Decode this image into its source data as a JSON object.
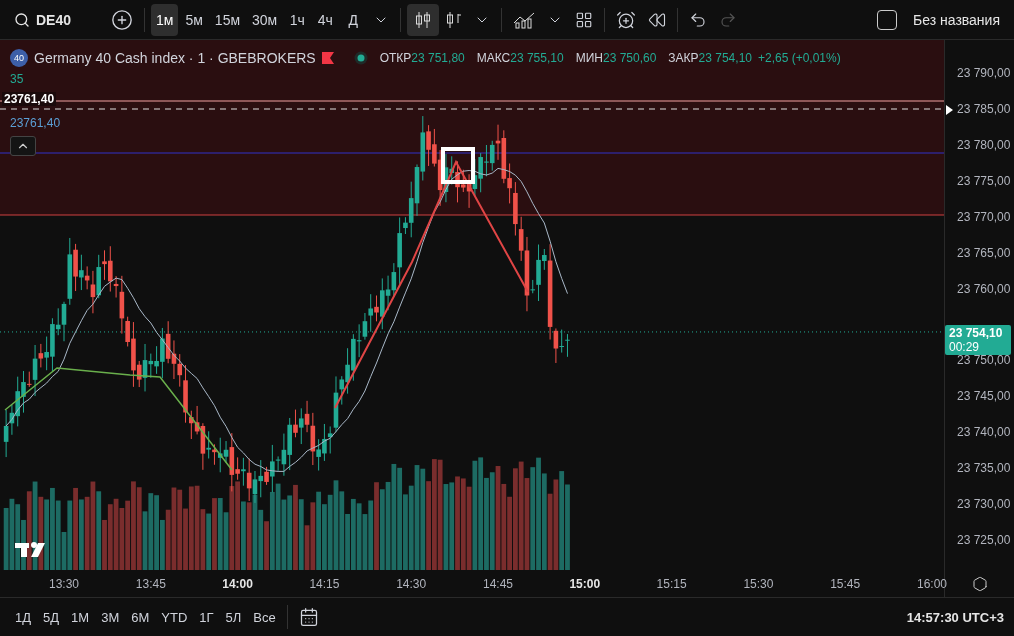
{
  "toolbar": {
    "symbol": "DE40",
    "timeframes": [
      {
        "label": "1м",
        "selected": true
      },
      {
        "label": "5м",
        "selected": false
      },
      {
        "label": "15м",
        "selected": false
      },
      {
        "label": "30м",
        "selected": false
      },
      {
        "label": "1ч",
        "selected": false
      },
      {
        "label": "4ч",
        "selected": false
      },
      {
        "label": "Д",
        "selected": false
      }
    ],
    "layout_name": "Без названия"
  },
  "legend": {
    "badge": "40",
    "title": "Germany 40 Cash index · 1 · GBEBROKERS",
    "ohlc": [
      {
        "label": "ОТКР",
        "value": "23 751,80"
      },
      {
        "label": "МАКС",
        "value": "23 755,10"
      },
      {
        "label": "МИН",
        "value": "23 750,60"
      },
      {
        "label": "ЗАКР",
        "value": "23 754,10"
      }
    ],
    "change": "+2,65 (+0,01%)",
    "volume": "35",
    "line_price": "23761,40",
    "level_price": "23761,40"
  },
  "price_axis": {
    "ticks": [
      "23 790,00",
      "23 785,00",
      "23 780,00",
      "23 775,00",
      "23 770,00",
      "23 765,00",
      "23 760,00",
      "23 750,00",
      "23 745,00",
      "23 740,00",
      "23 735,00",
      "23 730,00",
      "23 725,00"
    ],
    "last_price": "23 754,10",
    "countdown": "00:29"
  },
  "time_axis": {
    "ticks": [
      {
        "label": "13:30",
        "major": false
      },
      {
        "label": "13:45",
        "major": false
      },
      {
        "label": "14:00",
        "major": true
      },
      {
        "label": "14:15",
        "major": false
      },
      {
        "label": "14:30",
        "major": false
      },
      {
        "label": "14:45",
        "major": false
      },
      {
        "label": "15:00",
        "major": true
      },
      {
        "label": "15:15",
        "major": false
      },
      {
        "label": "15:30",
        "major": false
      },
      {
        "label": "15:45",
        "major": false
      },
      {
        "label": "16:00",
        "major": false
      }
    ]
  },
  "bottom_bar": {
    "ranges": [
      "1Д",
      "5Д",
      "1М",
      "3М",
      "6М",
      "YTD",
      "1Г",
      "5Л",
      "Все"
    ],
    "clock": "14:57:30 UTC+3"
  }
}
